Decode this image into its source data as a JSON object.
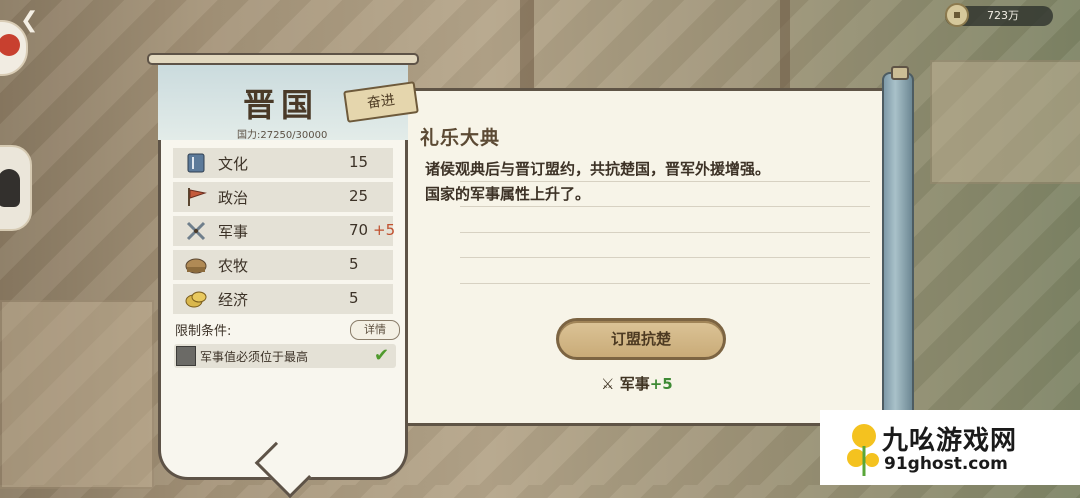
{
  "currency": {
    "value": "723万",
    "icon": "coin-icon"
  },
  "nation": {
    "name": "晋国",
    "power": "国力:27250/30000",
    "tag": "奋进"
  },
  "stats": [
    {
      "label": "文化",
      "value": "15",
      "bonus": "",
      "icon": "book-icon"
    },
    {
      "label": "政治",
      "value": "25",
      "bonus": "",
      "icon": "flag-icon"
    },
    {
      "label": "军事",
      "value": "70",
      "bonus": "+5",
      "icon": "crossed-swords-icon"
    },
    {
      "label": "农牧",
      "value": "5",
      "bonus": "",
      "icon": "hay-icon"
    },
    {
      "label": "经济",
      "value": "5",
      "bonus": "",
      "icon": "coins-icon"
    }
  ],
  "conditions": {
    "label": "限制条件:",
    "detail_button": "详情",
    "items": [
      {
        "text": "军事值必须位于最高",
        "met": true
      }
    ]
  },
  "event": {
    "title": "礼乐大典",
    "description_lines": [
      "诸侯观典后与晋订盟约，共抗楚国，晋军外援增强。",
      "国家的军事属性上升了。"
    ],
    "action_button": "订盟抗楚",
    "reward_label": "军事",
    "reward_value": "+5"
  },
  "watermark": {
    "title": "九吆游戏网",
    "url": "91ghost.com"
  },
  "colors": {
    "accent": "#c9ab78",
    "bonus": "#c0502f",
    "reward": "#3e8a34"
  }
}
